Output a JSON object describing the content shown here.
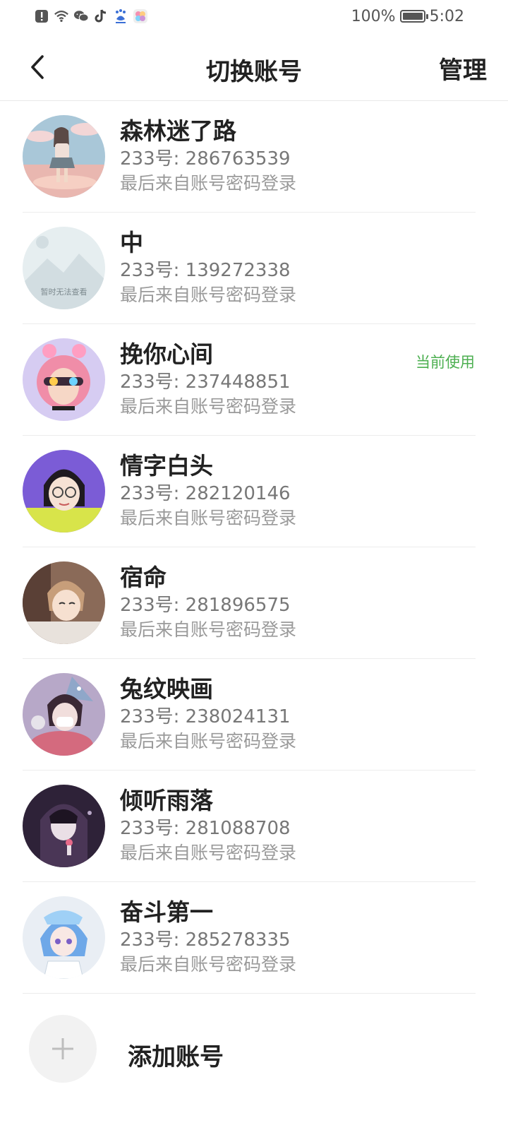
{
  "status_bar": {
    "icons": [
      "alert-icon",
      "wifi-icon",
      "wechat-icon",
      "tiktok-icon",
      "baidu-icon",
      "gallery-icon"
    ],
    "battery_percent": "100%",
    "time": "5:02"
  },
  "header": {
    "back_icon": "chevron-left-icon",
    "title": "切换账号",
    "manage": "管理"
  },
  "accounts": [
    {
      "name": "森林迷了路",
      "uid": "233号: 286763539",
      "login": "最后来自账号密码登录",
      "current": ""
    },
    {
      "name": "中",
      "uid": "233号: 139272338",
      "login": "最后来自账号密码登录",
      "current": "",
      "avatar_placeholder": "暂时无法查看"
    },
    {
      "name": "挽你心间",
      "uid": "233号: 237448851",
      "login": "最后来自账号密码登录",
      "current": "当前使用"
    },
    {
      "name": "情字白头",
      "uid": "233号: 282120146",
      "login": "最后来自账号密码登录",
      "current": ""
    },
    {
      "name": "宿命",
      "uid": "233号: 281896575",
      "login": "最后来自账号密码登录",
      "current": ""
    },
    {
      "name": "兔纹映画",
      "uid": "233号: 238024131",
      "login": "最后来自账号密码登录",
      "current": ""
    },
    {
      "name": "倾听雨落",
      "uid": "233号: 281088708",
      "login": "最后来自账号密码登录",
      "current": ""
    },
    {
      "name": "奋斗第一",
      "uid": "233号: 285278335",
      "login": "最后来自账号密码登录",
      "current": ""
    }
  ],
  "add_account": {
    "icon": "plus-icon",
    "label": "添加账号"
  },
  "colors": {
    "current_badge": "#4caf50",
    "divider": "#ececec",
    "secondary_text": "#777777"
  }
}
